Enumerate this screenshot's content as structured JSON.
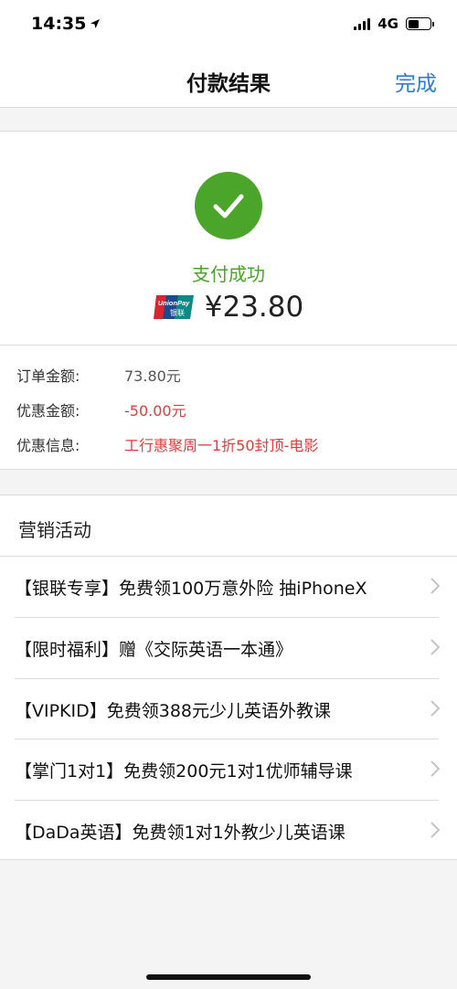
{
  "status_bar": {
    "time": "14:35",
    "network": "4G",
    "battery_level": 0.5
  },
  "nav": {
    "title": "付款结果",
    "done_label": "完成"
  },
  "result": {
    "status_text": "支付成功",
    "amount": "¥23.80",
    "card_logo_text": "UnionPay",
    "card_logo_cn": "银联"
  },
  "details": {
    "rows": [
      {
        "label": "订单金额:",
        "value": "73.80元"
      },
      {
        "label": "优惠金额:",
        "value": "-50.00元"
      },
      {
        "label": "优惠信息:",
        "value": "工行惠聚周一1折50封顶-电影"
      }
    ]
  },
  "marketing": {
    "title": "营销活动",
    "items": [
      {
        "text": "【银联专享】免费领100万意外险 抽iPhoneX"
      },
      {
        "text": "【限时福利】赠《交际英语一本通》"
      },
      {
        "text": "【VIPKID】免费领388元少儿英语外教课"
      },
      {
        "text": "【掌门1对1】免费领200元1对1优师辅导课"
      },
      {
        "text": "【DaDa英语】免费领1对1外教少儿英语课"
      }
    ]
  },
  "colors": {
    "accent_blue": "#2f7bd6",
    "success_green": "#4ba52a",
    "discount_red": "#e33b3b"
  },
  "icons": [
    "location-arrow-icon",
    "signal-icon",
    "battery-icon",
    "checkmark-icon",
    "unionpay-logo",
    "chevron-right-icon"
  ]
}
